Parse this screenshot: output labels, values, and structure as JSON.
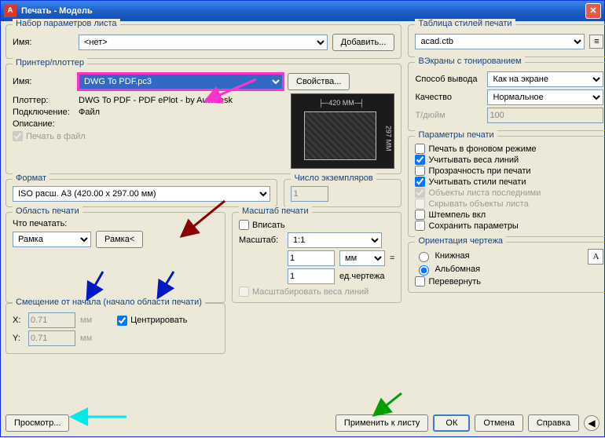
{
  "window": {
    "title": "Печать - Модель"
  },
  "pageset": {
    "legend": "Набор параметров листа",
    "name_label": "Имя:",
    "name_value": "<нет>",
    "add_btn": "Добавить..."
  },
  "printer": {
    "legend": "Принтер/плоттер",
    "name_label": "Имя:",
    "name_value": "DWG To PDF.pc3",
    "props_btn": "Свойства...",
    "plotter_label": "Плоттер:",
    "plotter_value": "DWG To PDF - PDF ePlot - by Autodesk",
    "conn_label": "Подключение:",
    "conn_value": "Файл",
    "desc_label": "Описание:",
    "tofile_label": "Печать в файл",
    "paper_w": "420 MM",
    "paper_h": "297 MM"
  },
  "format": {
    "legend": "Формат",
    "value": "ISO расш. A3 (420.00 x 297.00 мм)"
  },
  "copies": {
    "legend": "Число экземпляров",
    "value": "1"
  },
  "area": {
    "legend": "Область печати",
    "what_label": "Что печатать:",
    "value": "Рамка",
    "window_btn": "Рамка<"
  },
  "offset": {
    "legend": "Смещение от начала (начало области печати)",
    "x_label": "X:",
    "x_value": "0.71",
    "x_unit": "мм",
    "y_label": "Y:",
    "y_value": "0.71",
    "y_unit": "мм",
    "center_label": "Центрировать"
  },
  "scale": {
    "legend": "Масштаб печати",
    "fit_label": "Вписать",
    "scale_label": "Масштаб:",
    "scale_value": "1:1",
    "num_value": "1",
    "num_unit": "мм",
    "den_value": "1",
    "den_unit": "ед.чертежа",
    "eq": "=",
    "lw_label": "Масштабировать веса линий"
  },
  "styles": {
    "legend": "Таблица стилей печати",
    "value": "acad.ctb"
  },
  "viewport": {
    "legend": "ВЭкраны с тонированием",
    "output_label": "Способ вывода",
    "output_value": "Как на экране",
    "quality_label": "Качество",
    "quality_value": "Нормальное",
    "dpi_label": "Т/дюйм",
    "dpi_value": "100"
  },
  "options": {
    "legend": "Параметры печати",
    "bg": "Печать в фоновом режиме",
    "lw": "Учитывать веса линий",
    "transp": "Прозрачность при печати",
    "styles": "Учитывать стили печати",
    "last": "Объекты листа последними",
    "hide": "Скрывать объекты листа",
    "stamp": "Штемпель вкл",
    "save": "Сохранить параметры"
  },
  "orient": {
    "legend": "Ориентация чертежа",
    "portrait": "Книжная",
    "landscape": "Альбомная",
    "upside": "Перевернуть"
  },
  "footer": {
    "preview": "Просмотр...",
    "apply": "Применить к листу",
    "ok": "ОК",
    "cancel": "Отмена",
    "help": "Справка"
  }
}
